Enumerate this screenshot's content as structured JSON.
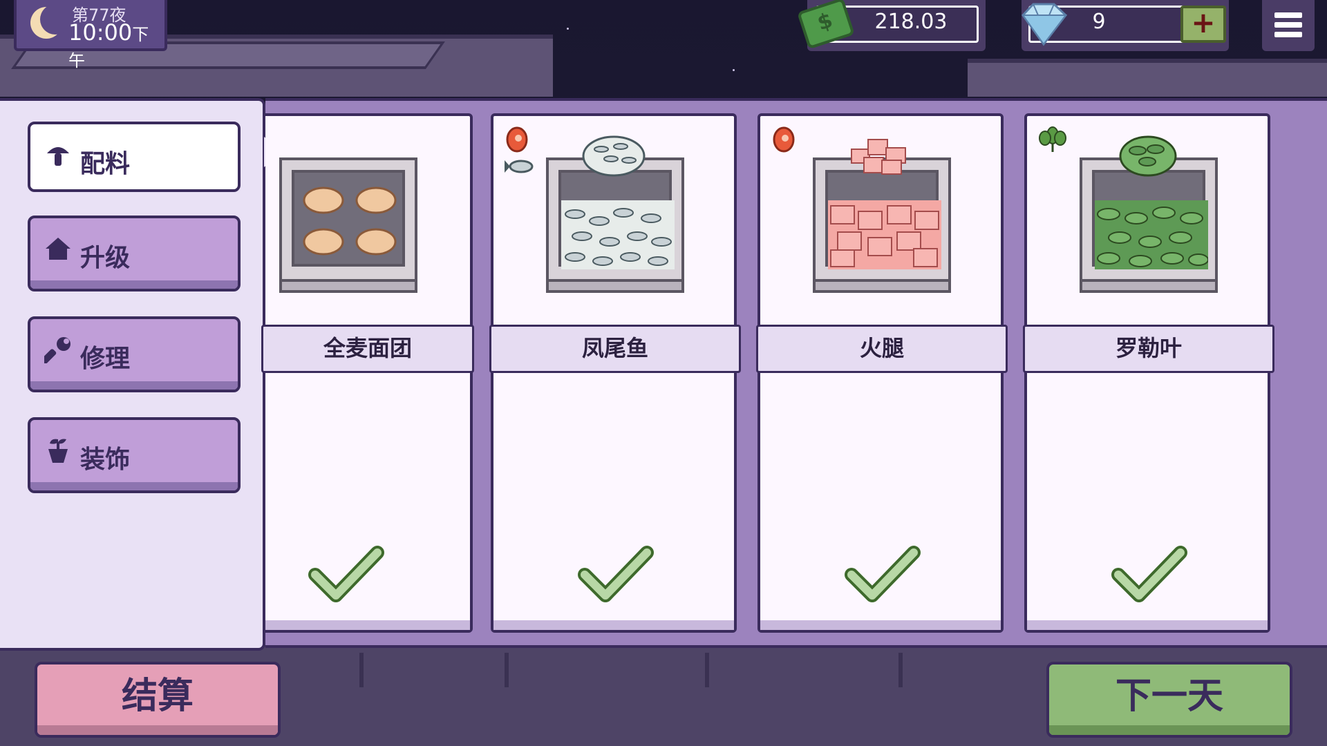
{
  "header": {
    "day": "第77夜",
    "time": "10:00",
    "time_suffix": "下午",
    "money": "218.03",
    "gems": "9",
    "plus_label": "+"
  },
  "sidebar": {
    "items": [
      {
        "label": "配料",
        "icon": "mushroom-icon",
        "active": true
      },
      {
        "label": "升级",
        "icon": "house-icon",
        "active": false
      },
      {
        "label": "修理",
        "icon": "wrench-icon",
        "active": false
      },
      {
        "label": "装饰",
        "icon": "plant-pot-icon",
        "active": false
      }
    ]
  },
  "ingredients": [
    {
      "name": "全麦面团",
      "tags": [],
      "selected": true
    },
    {
      "name": "凤尾鱼",
      "tags": [
        "meat-icon",
        "fish-icon"
      ],
      "selected": true
    },
    {
      "name": "火腿",
      "tags": [
        "meat-icon"
      ],
      "selected": true
    },
    {
      "name": "罗勒叶",
      "tags": [
        "vegetable-icon"
      ],
      "selected": true
    }
  ],
  "footer": {
    "settle_label": "结算",
    "next_day_label": "下一天"
  },
  "colors": {
    "panel": "#9c83be",
    "button": "#c09ed8",
    "settle": "#e59fb7",
    "next": "#8fba78",
    "check": "#9bc28a"
  }
}
